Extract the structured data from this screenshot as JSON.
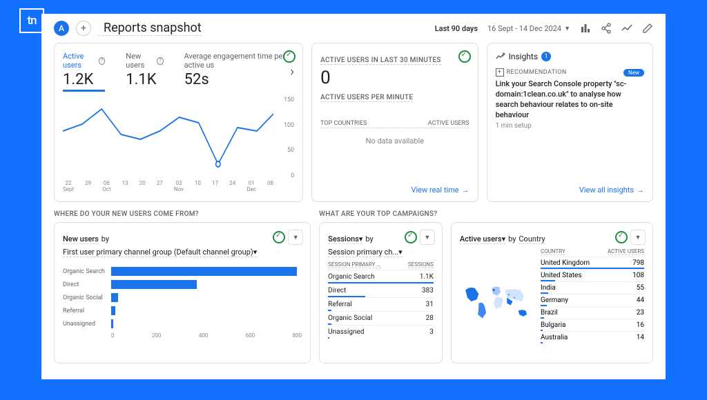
{
  "logo": "tn",
  "header": {
    "avatar": "A",
    "title": "Reports snapshot",
    "last_label": "Last 90 days",
    "date_range": "16 Sept - 14 Dec 2024"
  },
  "main_card": {
    "metrics": [
      {
        "label": "Active users",
        "value": "1.2K",
        "active": true
      },
      {
        "label": "New users",
        "value": "1.1K",
        "active": false
      },
      {
        "label": "Average engagement time per active us",
        "value": "52s",
        "active": false
      }
    ],
    "y_ticks": [
      "150",
      "100",
      "50",
      "0"
    ],
    "x_ticks": [
      "22\nSept",
      "29",
      "06\nOct",
      "13",
      "20",
      "27",
      "03\nNov",
      "10",
      "17",
      "24",
      "01\nDec",
      "08"
    ]
  },
  "realtime": {
    "title": "ACTIVE USERS IN LAST 30 MINUTES",
    "value": "0",
    "sub": "ACTIVE USERS PER MINUTE",
    "top_countries": "TOP COUNTRIES",
    "active_users": "ACTIVE USERS",
    "no_data": "No data available",
    "link": "View real time"
  },
  "insights": {
    "title": "Insights",
    "badge": "1",
    "rec_label": "RECOMMENDATION",
    "new": "New",
    "text": "Link your Search Console property \"sc-domain:1clean.co.uk\" to analyse how search behaviour relates to on-site behaviour",
    "setup": "1 min setup",
    "link": "View all insights"
  },
  "section_a": {
    "heading": "WHERE DO YOUR NEW USERS COME FROM?",
    "card_title": "New users",
    "by": "by",
    "subtitle": "First user primary channel group (Default channel group)",
    "axis": [
      "0",
      "200",
      "400",
      "600",
      "800"
    ]
  },
  "chart_data": {
    "type": "bar",
    "categories": [
      "Organic Search",
      "Direct",
      "Organic Social",
      "Referral",
      "Unassigned"
    ],
    "values": [
      780,
      360,
      28,
      18,
      8
    ],
    "xlabel": "",
    "ylabel": "New users",
    "xlim": [
      0,
      800
    ]
  },
  "section_b": {
    "heading": "WHAT ARE YOUR TOP CAMPAIGNS?",
    "sessions_title": "Sessions",
    "sessions_by": "by",
    "sessions_sub": "Session primary ch...",
    "col1": "SESSION PRIMARY ...",
    "col2": "SESSIONS",
    "rows": [
      {
        "name": "Organic Search",
        "val": "1.1K",
        "pct": 100
      },
      {
        "name": "Direct",
        "val": "383",
        "pct": 35
      },
      {
        "name": "Referral",
        "val": "31",
        "pct": 3
      },
      {
        "name": "Organic Social",
        "val": "28",
        "pct": 3
      },
      {
        "name": "Unassigned",
        "val": "3",
        "pct": 1
      }
    ],
    "active_title": "Active users",
    "active_by": "by",
    "active_dim": "Country",
    "country_col": "COUNTRY",
    "users_col": "ACTIVE USERS",
    "countries": [
      {
        "name": "United Kingdom",
        "val": "798",
        "pct": 100
      },
      {
        "name": "United States",
        "val": "108",
        "pct": 14
      },
      {
        "name": "India",
        "val": "55",
        "pct": 7
      },
      {
        "name": "Germany",
        "val": "44",
        "pct": 6
      },
      {
        "name": "Brazil",
        "val": "23",
        "pct": 3
      },
      {
        "name": "Bulgaria",
        "val": "16",
        "pct": 2
      },
      {
        "name": "Australia",
        "val": "14",
        "pct": 2
      }
    ]
  }
}
